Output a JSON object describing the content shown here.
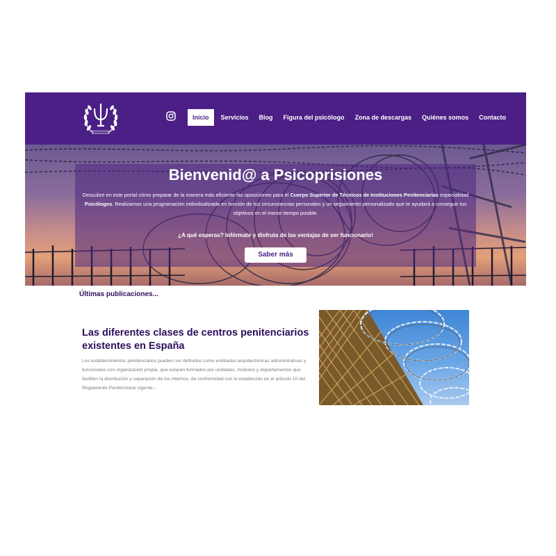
{
  "header": {
    "logo_text": "PSICOPRISIONES",
    "nav": [
      {
        "label": "Inicio",
        "active": true
      },
      {
        "label": "Servicios",
        "active": false
      },
      {
        "label": "Blog",
        "active": false
      },
      {
        "label": "Figura del psicólogo",
        "active": false
      },
      {
        "label": "Zona de descargas",
        "active": false
      },
      {
        "label": "Quiénes somos",
        "active": false
      },
      {
        "label": "Contacto",
        "active": false
      }
    ],
    "social_icon": "instagram-icon"
  },
  "hero": {
    "title": "Bienvenid@ a Psicoprisiones",
    "desc_part1": "Descubre en este portal cómo preparar de la manera más eficiente las oposiciones para el ",
    "desc_bold1": "Cuerpo Superior de Técnicos de Instituciones Penitenciarias",
    "desc_part2": " especialidad ",
    "desc_bold2": "Psicólogos",
    "desc_part3": ". Realizamos una programación individualizada en función de tus circunstancias personales y un seguimiento personalizado que te ayudará a conseguir tus objetivos en el menor tiempo posible.",
    "cta": "¿A qué esperas? Infórmate y disfruta de las ventajas de ser funcionario!",
    "button": "Saber más"
  },
  "publications": {
    "title": "Últimas publicaciones...",
    "post": {
      "title": "Las diferentes clases de centros penitenciarios existentes en España",
      "excerpt": "Los establecimientos penitenciarios pueden ser definidos como entidades arquitectónicas administrativas y funcionales con organización propia, que estarán formados por unidades, módulos y departamentos que faciliten la distribución y separación de los internos, de conformidad con lo establecido en el artículo 10 del Reglamento Penitenciario vigente..."
    }
  },
  "colors": {
    "brand": "#4b1f86",
    "text_dark": "#2d0f5a",
    "excerpt": "#7a7a7a"
  }
}
